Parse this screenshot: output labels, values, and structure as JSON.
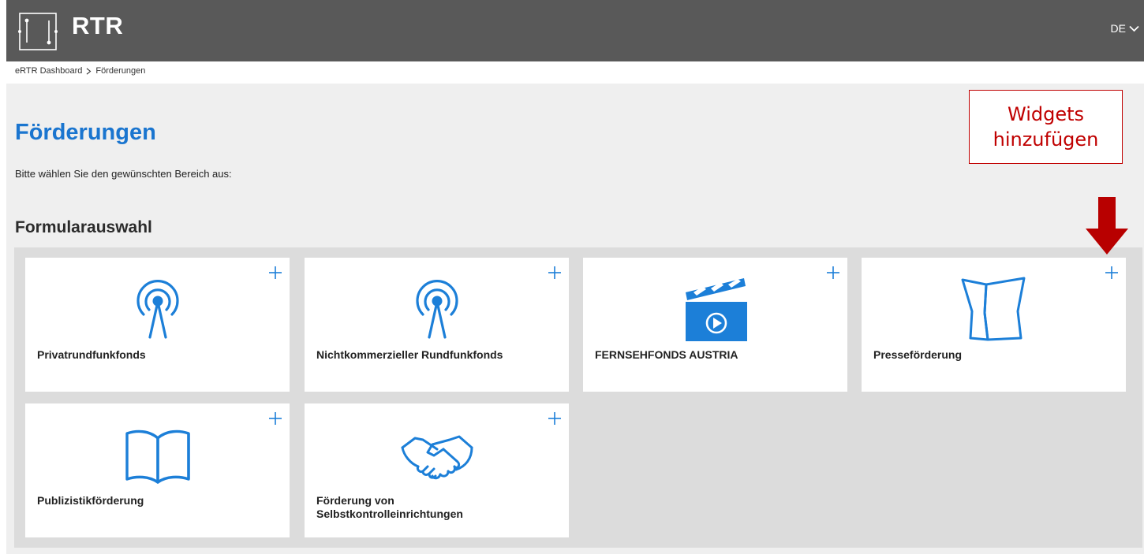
{
  "header": {
    "logo_text": "RTR",
    "language": "DE"
  },
  "breadcrumb": {
    "items": [
      "eRTR Dashboard",
      "Förderungen"
    ]
  },
  "page": {
    "title": "Förderungen",
    "intro": "Bitte wählen Sie den gewünschten Bereich aus:",
    "section_title": "Formularauswahl"
  },
  "tiles": [
    {
      "label": "Privatrundfunkfonds",
      "icon": "antenna-icon"
    },
    {
      "label": "Nichtkommerzieller Rundfunkfonds",
      "icon": "antenna-icon"
    },
    {
      "label": "FERNSEHFONDS AUSTRIA",
      "icon": "clapperboard-icon"
    },
    {
      "label": "Presseförderung",
      "icon": "newspaper-icon"
    },
    {
      "label": "Publizistikförderung",
      "icon": "open-book-icon"
    },
    {
      "label": "Förderung von\nSelbstkontrolleinrichtungen",
      "icon": "handshake-icon"
    }
  ],
  "annotation": {
    "text_line1": "Widgets",
    "text_line2": "hinzufügen"
  },
  "colors": {
    "header_bg": "#595959",
    "accent_blue": "#1a75cf",
    "icon_blue": "#1c7fd8",
    "annotation_red": "#c00000",
    "arrow_red": "#b80000"
  }
}
